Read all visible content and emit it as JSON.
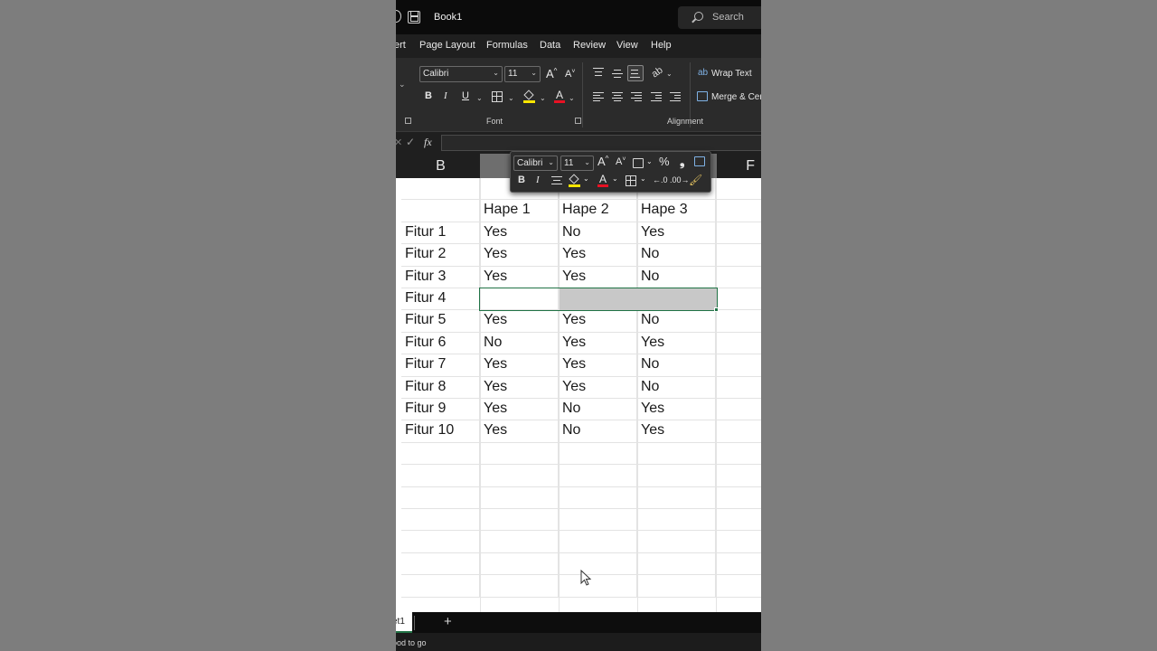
{
  "titlebar": {
    "title": "Book1",
    "search_placeholder": "Search"
  },
  "menu": {
    "tabs": [
      "ert",
      "Page Layout",
      "Formulas",
      "Data",
      "Review",
      "View",
      "Help"
    ]
  },
  "ribbon": {
    "font_name": "Calibri",
    "font_size": "11",
    "grow_font": "A",
    "shrink_font": "A",
    "bold": "B",
    "italic": "I",
    "underline": "U",
    "font_group_label": "Font",
    "alignment_group_label": "Alignment",
    "wrap_text": "Wrap Text",
    "merge_center": "Merge & Cer"
  },
  "formula_bar": {
    "fx": "fx",
    "cancel": "✕",
    "enter": "✓",
    "value": ""
  },
  "columns": {
    "b": "B",
    "f": "F"
  },
  "mini_toolbar": {
    "font_name": "Calibri",
    "font_size": "11",
    "percent": "%",
    "comma": "❟",
    "bold": "B",
    "italic": "I"
  },
  "table": {
    "headers": [
      "",
      "Hape 1",
      "Hape 2",
      "Hape 3"
    ],
    "rows": [
      [
        "Fitur 1",
        "Yes",
        "No",
        "Yes"
      ],
      [
        "Fitur 2",
        "Yes",
        "Yes",
        "No"
      ],
      [
        "Fitur 3",
        "Yes",
        "Yes",
        "No"
      ],
      [
        "Fitur 4",
        "",
        "",
        ""
      ],
      [
        "Fitur 5",
        "Yes",
        "Yes",
        "No"
      ],
      [
        "Fitur 6",
        "No",
        "Yes",
        "Yes"
      ],
      [
        "Fitur 7",
        "Yes",
        "Yes",
        "No"
      ],
      [
        "Fitur 8",
        "Yes",
        "Yes",
        "No"
      ],
      [
        "Fitur 9",
        "Yes",
        "No",
        "Yes"
      ],
      [
        "Fitur 10",
        "Yes",
        "No",
        "Yes"
      ]
    ]
  },
  "sheet_tabs": {
    "active": "et1",
    "add": "+"
  },
  "status": {
    "text": "ood to go"
  },
  "colors": {
    "accent_green": "#217346",
    "fill_highlight": "#ffe600",
    "font_red": "#e81123",
    "selection_gray": "#c8c8c8"
  }
}
